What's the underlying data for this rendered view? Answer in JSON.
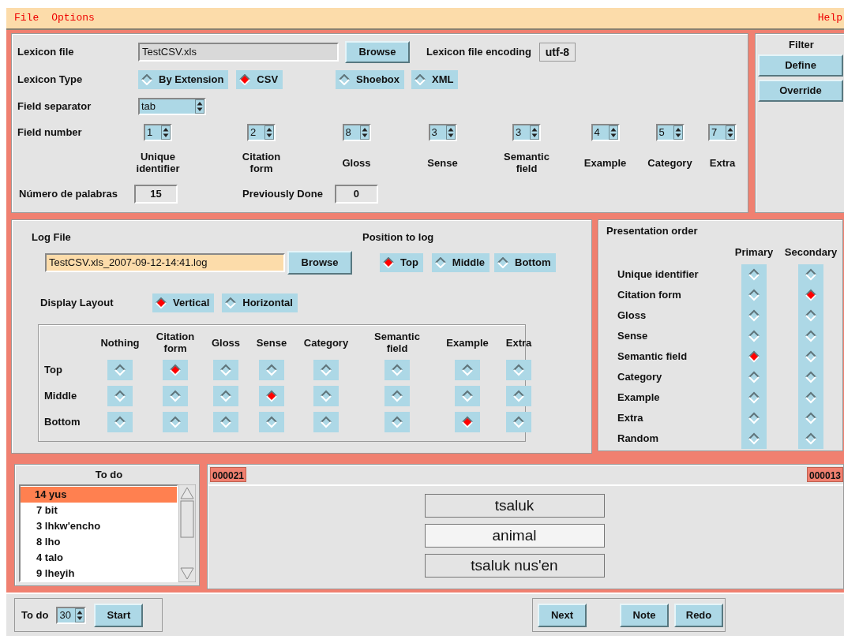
{
  "menu": [
    {
      "label": "File"
    },
    {
      "label": "Options"
    }
  ],
  "help_menu": {
    "label": "Help"
  },
  "lexicon": {
    "file_label": "Lexicon file",
    "file_value": "TestCSV.xls",
    "browse": "Browse",
    "encoding_label": "Lexicon file encoding",
    "encoding_value": "utf-8",
    "type_label": "Lexicon Type",
    "types": [
      {
        "label": "By Extension",
        "selected": false
      },
      {
        "label": "CSV",
        "selected": true
      },
      {
        "label": "Shoebox",
        "selected": false
      },
      {
        "label": "XML",
        "selected": false
      }
    ],
    "separator_label": "Field separator",
    "separator_value": "tab",
    "field_number_label": "Field number",
    "fields": [
      {
        "value": "1",
        "label": "Unique identifier"
      },
      {
        "value": "2",
        "label": "Citation form"
      },
      {
        "value": "8",
        "label": "Gloss"
      },
      {
        "value": "3",
        "label": "Sense"
      },
      {
        "value": "3",
        "label": "Semantic field"
      },
      {
        "value": "4",
        "label": "Example"
      },
      {
        "value": "5",
        "label": "Category"
      },
      {
        "value": "7",
        "label": "Extra"
      }
    ],
    "count_label": "Número de palabras",
    "count_value": "15",
    "done_label": "Previously Done",
    "done_value": "0"
  },
  "filter": {
    "title": "Filter",
    "buttons": [
      "Define",
      "Override"
    ]
  },
  "log": {
    "label": "Log File",
    "value": "TestCSV.xls_2007-09-12-14:41.log",
    "browse": "Browse",
    "position_label": "Position to log",
    "positions": [
      {
        "label": "Top",
        "selected": true
      },
      {
        "label": "Middle",
        "selected": false
      },
      {
        "label": "Bottom",
        "selected": false
      }
    ],
    "layout_label": "Display Layout",
    "layouts": [
      {
        "label": "Vertical",
        "selected": true
      },
      {
        "label": "Horizontal",
        "selected": false
      }
    ],
    "grid": {
      "columns": [
        "Nothing",
        "Citation form",
        "Gloss",
        "Sense",
        "Category",
        "Semantic field",
        "Example",
        "Extra"
      ],
      "rows": [
        {
          "label": "Top",
          "cells": [
            {
              "selected": false
            },
            {
              "selected": true
            },
            {
              "selected": false
            },
            {
              "selected": false
            },
            {
              "selected": false
            },
            {
              "selected": false
            },
            {
              "selected": false
            },
            {
              "selected": false
            }
          ]
        },
        {
          "label": "Middle",
          "cells": [
            {
              "selected": false
            },
            {
              "selected": false
            },
            {
              "selected": false
            },
            {
              "selected": true
            },
            {
              "selected": false
            },
            {
              "selected": false
            },
            {
              "selected": false
            },
            {
              "selected": false
            }
          ]
        },
        {
          "label": "Bottom",
          "cells": [
            {
              "selected": false
            },
            {
              "selected": false
            },
            {
              "selected": false
            },
            {
              "selected": false
            },
            {
              "selected": false
            },
            {
              "selected": false
            },
            {
              "selected": true
            },
            {
              "selected": false
            }
          ]
        }
      ]
    }
  },
  "presentation": {
    "title": "Presentation order",
    "columns": [
      "Primary",
      "Secondary"
    ],
    "rows": [
      {
        "label": "Unique identifier",
        "primary": false,
        "secondary": false
      },
      {
        "label": "Citation form",
        "primary": false,
        "secondary": true
      },
      {
        "label": "Gloss",
        "primary": false,
        "secondary": false
      },
      {
        "label": "Sense",
        "primary": false,
        "secondary": false
      },
      {
        "label": "Semantic field",
        "primary": true,
        "secondary": false
      },
      {
        "label": "Category",
        "primary": false,
        "secondary": false
      },
      {
        "label": "Example",
        "primary": false,
        "secondary": false
      },
      {
        "label": "Extra",
        "primary": false,
        "secondary": false
      },
      {
        "label": "Random",
        "primary": false,
        "secondary": false
      }
    ]
  },
  "todo": {
    "title": "To do",
    "items": [
      {
        "label": "14 yus",
        "selected": true
      },
      {
        "label": "7 bit",
        "selected": false
      },
      {
        "label": "3 lhkw'encho",
        "selected": false
      },
      {
        "label": "8 lho",
        "selected": false
      },
      {
        "label": "4 talo",
        "selected": false
      },
      {
        "label": "9 lheyih",
        "selected": false
      }
    ]
  },
  "display": {
    "left_id": "000021",
    "right_id": "000013",
    "words": [
      {
        "text": "tsaluk",
        "highlighted": false
      },
      {
        "text": "animal",
        "highlighted": true
      },
      {
        "text": "tsaluk nus'en",
        "highlighted": false
      }
    ]
  },
  "footer": {
    "todo_label": "To do",
    "todo_value": "30",
    "start": "Start",
    "buttons": [
      "Next",
      "Note",
      "Redo"
    ]
  }
}
